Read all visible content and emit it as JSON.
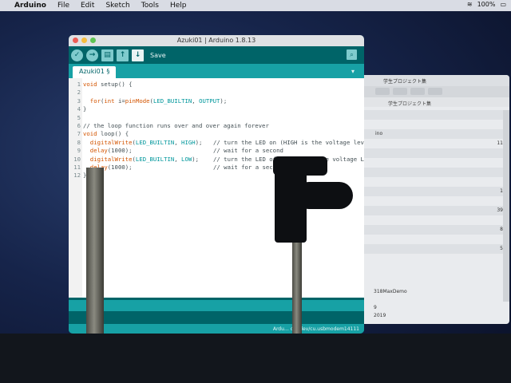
{
  "menubar": {
    "app": "Arduino",
    "items": [
      "File",
      "Edit",
      "Sketch",
      "Tools",
      "Help"
    ],
    "status": "100%"
  },
  "finder": {
    "title": "学生プロジェクト集",
    "path": "学生プロジェクト集",
    "rows": [
      {
        "name": "",
        "num": ""
      },
      {
        "name": "",
        "num": ""
      },
      {
        "name": "ino",
        "num": ""
      },
      {
        "name": "",
        "num": "11"
      },
      {
        "name": "",
        "num": ""
      },
      {
        "name": "",
        "num": ""
      },
      {
        "name": "",
        "num": ""
      },
      {
        "name": "",
        "num": ""
      },
      {
        "name": "",
        "num": "1"
      },
      {
        "name": "",
        "num": ""
      },
      {
        "name": "",
        "num": "39"
      },
      {
        "name": "",
        "num": ""
      },
      {
        "name": "",
        "num": "8"
      },
      {
        "name": "",
        "num": ""
      },
      {
        "name": "",
        "num": "5"
      }
    ],
    "lower_items": [
      "318MaxDemo",
      "9",
      "2019"
    ]
  },
  "arduino": {
    "window_title": "Azuki01 | Arduino 1.8.13",
    "toolbar": {
      "verify_icon": "check-icon",
      "upload_icon": "arrow-right-icon",
      "new_icon": "document-icon",
      "open_icon": "arrow-up-icon",
      "save_icon": "arrow-down-icon",
      "hover_label": "Save",
      "serial_icon": "magnifier-icon"
    },
    "tab": "Azuki01 §",
    "tab_menu": "▾",
    "status_text": "Ardu…   on /dev/cu.usbmodem14111",
    "code_lines": [
      {
        "n": "1",
        "code": "void setup() {",
        "comment": ""
      },
      {
        "n": "2",
        "code": "",
        "comment": ""
      },
      {
        "n": "3",
        "code": "  for(int i=pinMode(LED_BUILTIN, OUTPUT);",
        "comment": ""
      },
      {
        "n": "4",
        "code": "}",
        "comment": ""
      },
      {
        "n": "5",
        "code": "",
        "comment": ""
      },
      {
        "n": "6",
        "code": "// the loop function runs over and over again forever",
        "comment": ""
      },
      {
        "n": "7",
        "code": "void loop() {",
        "comment": ""
      },
      {
        "n": "8",
        "code": "  digitalWrite(LED_BUILTIN, HIGH);",
        "comment": "// turn the LED on (HIGH is the voltage level)"
      },
      {
        "n": "9",
        "code": "  delay(1000);",
        "comment": "// wait for a second"
      },
      {
        "n": "10",
        "code": "  digitalWrite(LED_BUILTIN, LOW);",
        "comment": "// turn the LED off by making the voltage LOW"
      },
      {
        "n": "11",
        "code": "  delay(1000);",
        "comment": "// wait for a second"
      },
      {
        "n": "12",
        "code": "}",
        "comment": ""
      }
    ]
  },
  "colors": {
    "arduino_teal_dark": "#006468",
    "arduino_teal_light": "#17a1a5",
    "arduino_button": "#7fcbcd",
    "keyword_orange": "#d35400",
    "type_teal": "#00979c"
  }
}
